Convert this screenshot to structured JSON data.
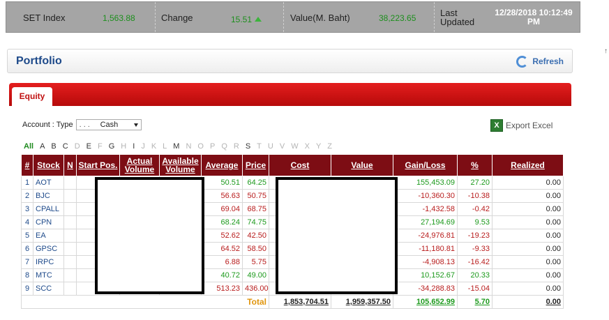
{
  "index_bar": {
    "set_label": "SET Index",
    "set_value": "1,563.88",
    "change_label": "Change",
    "change_value": "15.51",
    "value_label": "Value(M. Baht)",
    "value_value": "38,223.65",
    "updated_label": "Last Updated",
    "updated_value": "12/28/2018 10:12:49 PM",
    "side_mark": "↑"
  },
  "portfolio": {
    "title": "Portfolio",
    "refresh_label": "Refresh"
  },
  "tabs": [
    {
      "label": "Equity",
      "active": true
    }
  ],
  "account": {
    "label": "Account : Type",
    "type_masked": ". . .",
    "type_value": "Cash"
  },
  "export_label": "Export Excel",
  "letters": [
    {
      "label": "All",
      "state": "all"
    },
    {
      "label": "A",
      "state": "active"
    },
    {
      "label": "B",
      "state": "active"
    },
    {
      "label": "C",
      "state": "active"
    },
    {
      "label": "D",
      "state": "inactive"
    },
    {
      "label": "E",
      "state": "active"
    },
    {
      "label": "F",
      "state": "inactive"
    },
    {
      "label": "G",
      "state": "active"
    },
    {
      "label": "H",
      "state": "inactive"
    },
    {
      "label": "I",
      "state": "active"
    },
    {
      "label": "J",
      "state": "inactive"
    },
    {
      "label": "K",
      "state": "inactive"
    },
    {
      "label": "L",
      "state": "inactive"
    },
    {
      "label": "M",
      "state": "active"
    },
    {
      "label": "N",
      "state": "inactive"
    },
    {
      "label": "O",
      "state": "inactive"
    },
    {
      "label": "P",
      "state": "inactive"
    },
    {
      "label": "Q",
      "state": "inactive"
    },
    {
      "label": "R",
      "state": "inactive"
    },
    {
      "label": "S",
      "state": "active"
    },
    {
      "label": "T",
      "state": "inactive"
    },
    {
      "label": "U",
      "state": "inactive"
    },
    {
      "label": "V",
      "state": "inactive"
    },
    {
      "label": "W",
      "state": "inactive"
    },
    {
      "label": "X",
      "state": "inactive"
    },
    {
      "label": "Y",
      "state": "inactive"
    },
    {
      "label": "Z",
      "state": "inactive"
    }
  ],
  "table": {
    "headers": [
      "#",
      "Stock",
      "N",
      "Start Pos.",
      "Actual Volume",
      "Available Volume",
      "Average",
      "Price",
      "Cost",
      "Value",
      "Gain/Loss",
      "%",
      "Realized"
    ],
    "rows": [
      {
        "idx": "1",
        "stock": "AOT",
        "average": "50.51",
        "price": "64.25",
        "gain": "155,453.09",
        "pct": "27.20",
        "realized": "0.00",
        "dir": "up"
      },
      {
        "idx": "2",
        "stock": "BJC",
        "average": "56.63",
        "price": "50.75",
        "gain": "-10,360.30",
        "pct": "-10.38",
        "realized": "0.00",
        "dir": "down"
      },
      {
        "idx": "3",
        "stock": "CPALL",
        "average": "69.04",
        "price": "68.75",
        "gain": "-1,432.58",
        "pct": "-0.42",
        "realized": "0.00",
        "dir": "down"
      },
      {
        "idx": "4",
        "stock": "CPN",
        "average": "68.24",
        "price": "74.75",
        "gain": "27,194.69",
        "pct": "9.53",
        "realized": "0.00",
        "dir": "up"
      },
      {
        "idx": "5",
        "stock": "EA",
        "average": "52.62",
        "price": "42.50",
        "gain": "-24,976.81",
        "pct": "-19.23",
        "realized": "0.00",
        "dir": "down"
      },
      {
        "idx": "6",
        "stock": "GPSC",
        "average": "64.52",
        "price": "58.50",
        "gain": "-11,180.81",
        "pct": "-9.33",
        "realized": "0.00",
        "dir": "down"
      },
      {
        "idx": "7",
        "stock": "IRPC",
        "average": "6.88",
        "price": "5.75",
        "gain": "-4,908.13",
        "pct": "-16.42",
        "realized": "0.00",
        "dir": "down"
      },
      {
        "idx": "8",
        "stock": "MTC",
        "average": "40.72",
        "price": "49.00",
        "gain": "10,152.67",
        "pct": "20.33",
        "realized": "0.00",
        "dir": "up"
      },
      {
        "idx": "9",
        "stock": "SCC",
        "average": "513.23",
        "price": "436.00",
        "gain": "-34,288.83",
        "pct": "-15.04",
        "realized": "0.00",
        "dir": "down"
      }
    ],
    "total": {
      "label": "Total",
      "cost": "1,853,704.51",
      "value": "1,959,357.50",
      "gain": "105,652.99",
      "pct": "5.70",
      "realized": "0.00"
    }
  },
  "colors": {
    "header_bg": "#7d0d14",
    "tab_bar": "#d41414",
    "positive": "#1d9a1d",
    "negative": "#b81c1c",
    "total_label": "#e0950d"
  }
}
